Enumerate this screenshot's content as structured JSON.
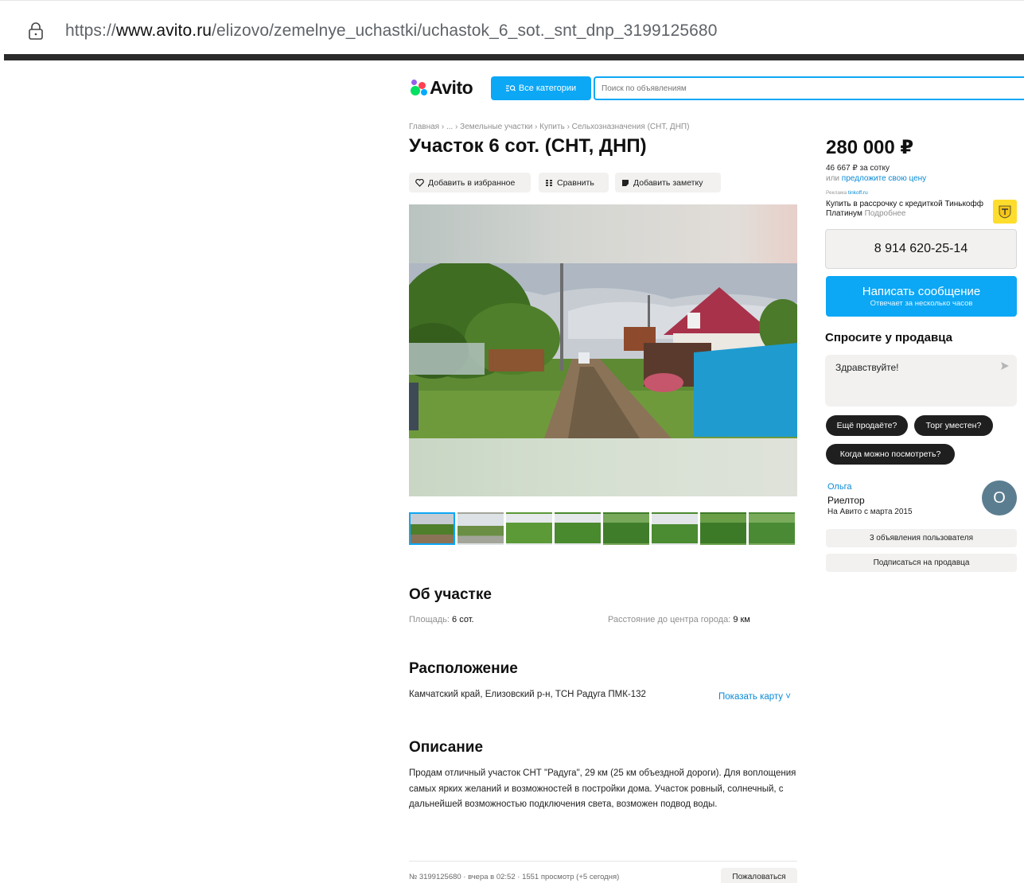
{
  "browser": {
    "url_scheme": "https://",
    "url_host": "www.avito.ru",
    "url_path": "/elizovo/zemelnye_uchastki/uchastok_6_sot._snt_dnp_3199125680"
  },
  "header": {
    "logo_text": "Avito",
    "categories_label": "Все категории",
    "search_placeholder": "Поиск по объявлениям"
  },
  "breadcrumb": "Главная › ... › Земельные участки › Купить › Сельхозназначения (СНТ, ДНП)",
  "listing": {
    "title": "Участок 6 сот. (СНТ, ДНП)",
    "actions": {
      "favorite": "Добавить в избранное",
      "compare": "Сравнить",
      "note": "Добавить заметку"
    },
    "thumbnails_count": 8
  },
  "about": {
    "heading": "Об участке",
    "area_label": "Площадь:",
    "area_value": "6 сот.",
    "distance_label": "Расстояние до центра города:",
    "distance_value": "9 км"
  },
  "location": {
    "heading": "Расположение",
    "address": "Камчатский край, Елизовский р-н, ТСН Радуга ПМК-132",
    "map_link": "Показать карту ˅"
  },
  "description": {
    "heading": "Описание",
    "text": "Продам отличный участок СНТ \"Радуга\", 29 км (25 км объездной дороги). Для воплощения самых ярких желаний и возможностей в постройки дома. Участок ровный, солнечный, с дальнейшей возможностью подключения света, возможен подвод воды."
  },
  "footer": {
    "meta": "№ 3199125680 · вчера в 02:52 · 1551 просмотр (+5 сегодня)",
    "report": "Пожаловаться"
  },
  "sidebar": {
    "price": "280 000 ₽",
    "per_unit": "46 667 ₽ за сотку",
    "offer_prefix": "или ",
    "offer_link": "предложите свою цену",
    "ad_label": "Реклама",
    "ad_domain": "tinkoff.ru",
    "ad_text": "Купить в рассрочку с кредиткой Тинькофф Платинум",
    "ad_more": "Подробнее",
    "phone": "8 914 620-25-14",
    "message_title": "Написать сообщение",
    "message_sub": "Отвечает за несколько часов",
    "ask_title": "Спросите у продавца",
    "ask_text": "Здравствуйте!",
    "chips": [
      "Ещё продаёте?",
      "Торг уместен?",
      "Когда можно посмотреть?"
    ],
    "seller_name": "Ольга",
    "seller_role": "Риелтор",
    "seller_since": "На Авито с марта 2015",
    "avatar_letter": "О",
    "user_ads": "3 объявления пользователя",
    "subscribe": "Подписаться на продавца"
  },
  "colors": {
    "accent": "#0ca7f5",
    "link": "#0a8ad6",
    "chip_bg": "#1f1f1f",
    "button_bg": "#f2f1f0"
  }
}
